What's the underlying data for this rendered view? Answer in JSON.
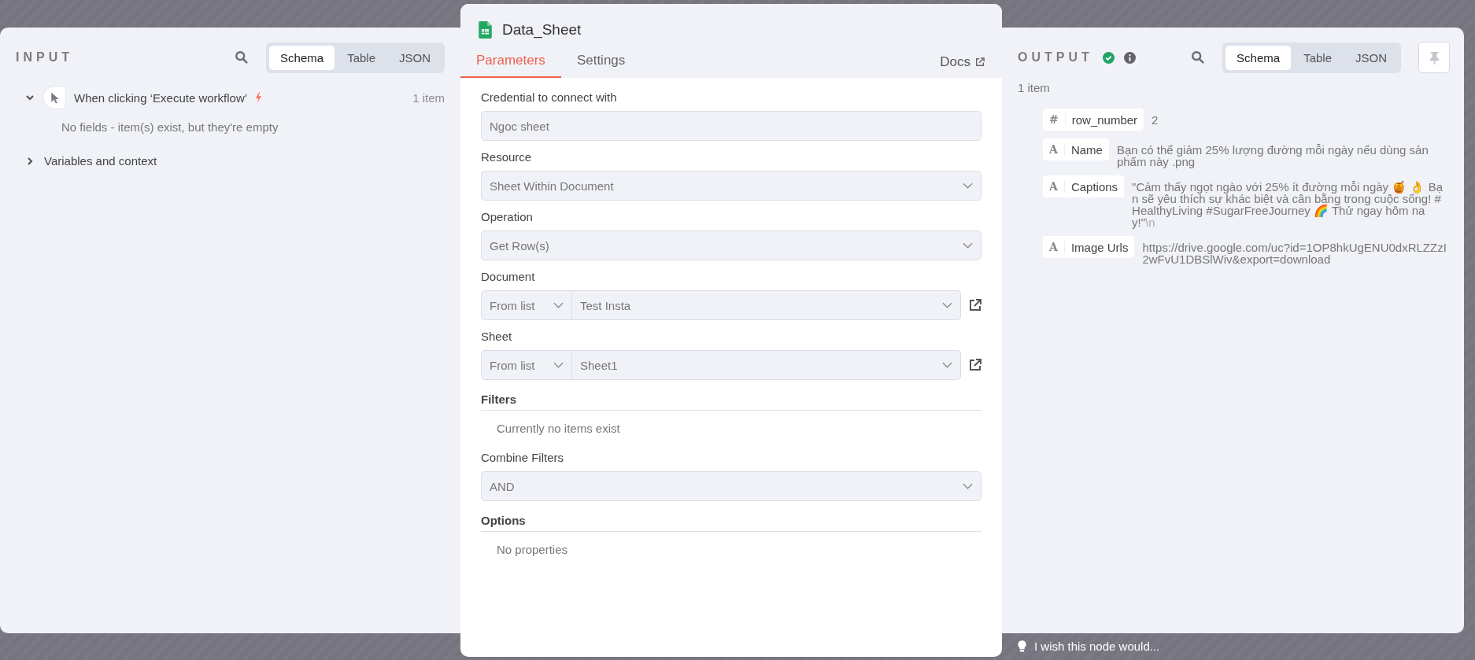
{
  "input_panel": {
    "title": "INPUT",
    "tabs": [
      {
        "label": "Schema",
        "selected": true
      },
      {
        "label": "Table",
        "selected": false
      },
      {
        "label": "JSON",
        "selected": false
      }
    ],
    "trigger": {
      "label": "When clicking ‘Execute workflow’",
      "expanded": true,
      "count": "1 item",
      "message": "No fields - item(s) exist, but they're empty"
    },
    "context": {
      "label": "Variables and context",
      "expanded": false
    }
  },
  "node": {
    "title": "Data_Sheet",
    "tabs": [
      {
        "label": "Parameters",
        "selected": true
      },
      {
        "label": "Settings",
        "selected": false
      }
    ],
    "docs": "Docs",
    "fields": [
      {
        "kind": "input",
        "label": "Credential to connect with",
        "value": "Ngoc sheet"
      },
      {
        "kind": "select",
        "label": "Resource",
        "value": "Sheet Within Document"
      },
      {
        "kind": "select",
        "label": "Operation",
        "value": "Get Row(s)"
      },
      {
        "kind": "locator",
        "label": "Document",
        "mode": "From list",
        "value": "Test Insta"
      },
      {
        "kind": "locator",
        "label": "Sheet",
        "mode": "From list",
        "value": "Sheet1"
      },
      {
        "kind": "section",
        "label": "Filters",
        "empty": "Currently no items exist"
      },
      {
        "kind": "select",
        "label": "Combine Filters",
        "value": "AND"
      },
      {
        "kind": "section",
        "label": "Options",
        "empty": "No properties"
      }
    ]
  },
  "output_panel": {
    "title": "OUTPUT",
    "tabs": [
      {
        "label": "Schema",
        "selected": true
      },
      {
        "label": "Table",
        "selected": false
      },
      {
        "label": "JSON",
        "selected": false
      }
    ],
    "count": "1 item",
    "fields": [
      {
        "type_icon": "#",
        "name": "row_number",
        "value": "2"
      },
      {
        "type_icon": "A",
        "name": "Name",
        "value": "Bạn có thể giảm 25% lượng đường mỗi ngày nếu dùng sản phẩm này .png"
      },
      {
        "type_icon": "A",
        "name": "Captions",
        "value": "\"Cảm thấy ngọt ngào với 25% ít đường mỗi ngày 🍯 👌 Bạn sẽ yêu thích sự khác biệt và cân bằng trong cuộc sống! #HealthyLiving #SugarFreeJourney 🌈 Thử ngay hôm nay!\"",
        "escape": "\\n"
      },
      {
        "type_icon": "A",
        "name": "Image Urls",
        "value": "https://drive.google.com/uc?id=1OP8hkUgENU0dxRLZZzI2wFvU1DBSlWiv&export=download"
      }
    ]
  },
  "feedback": {
    "value": "I wish this node would..."
  }
}
